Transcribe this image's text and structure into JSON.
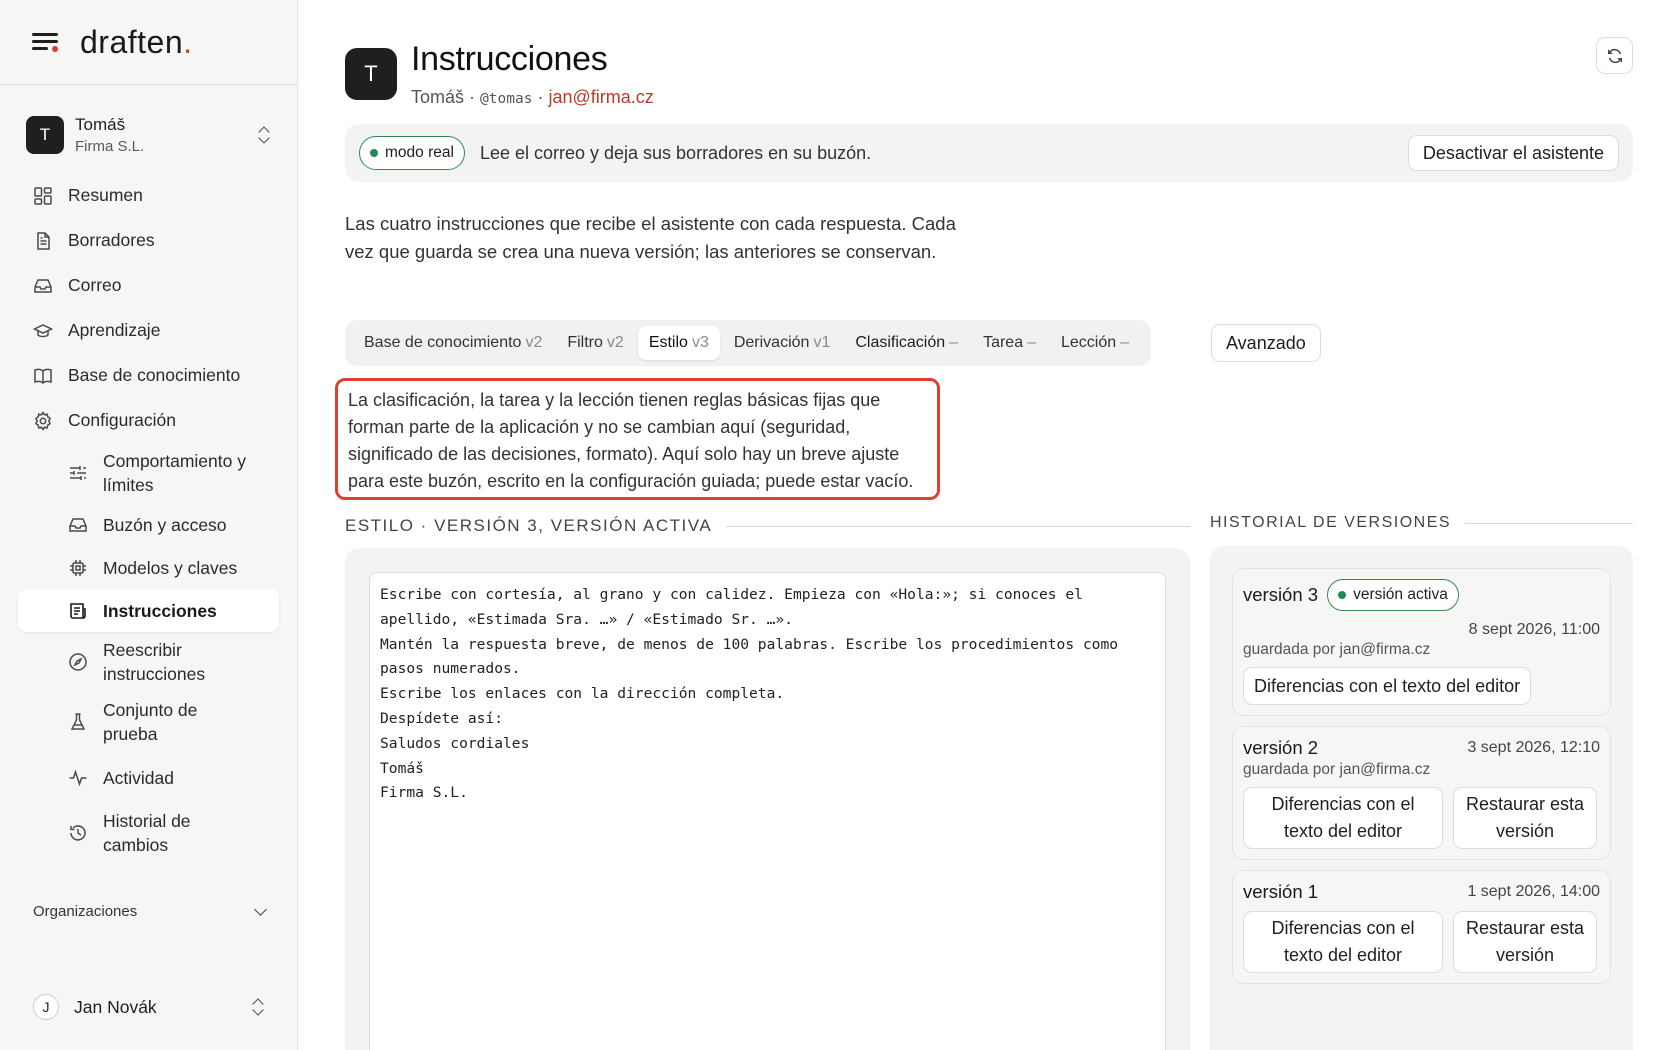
{
  "brand": {
    "name": "draften",
    "dot": "."
  },
  "account": {
    "initial": "T",
    "name": "Tomáš",
    "company": "Firma S.L."
  },
  "nav": {
    "items": [
      {
        "label": "Resumen",
        "icon": "dashboard-icon"
      },
      {
        "label": "Borradores",
        "icon": "document-icon"
      },
      {
        "label": "Correo",
        "icon": "inbox-icon"
      },
      {
        "label": "Aprendizaje",
        "icon": "graduation-cap-icon"
      },
      {
        "label": "Base de conocimiento",
        "icon": "book-icon"
      },
      {
        "label": "Configuración",
        "icon": "gear-icon"
      }
    ],
    "sub_items": [
      {
        "label": "Comportamiento y límites",
        "icon": "sliders-icon"
      },
      {
        "label": "Buzón y acceso",
        "icon": "inbox-icon"
      },
      {
        "label": "Modelos y claves",
        "icon": "chip-icon"
      },
      {
        "label": "Instrucciones",
        "icon": "instructions-icon"
      },
      {
        "label": "Reescribir instrucciones",
        "icon": "compass-icon"
      },
      {
        "label": "Conjunto de prueba",
        "icon": "flask-icon"
      },
      {
        "label": "Actividad",
        "icon": "activity-icon"
      },
      {
        "label": "Historial de cambios",
        "icon": "history-icon"
      }
    ],
    "orgs_label": "Organizaciones"
  },
  "user": {
    "initial": "J",
    "name": "Jan Novák"
  },
  "header": {
    "initial": "T",
    "title": "Instrucciones",
    "name": "Tomáš",
    "sep": "·",
    "handle": "@tomas",
    "email": "jan@firma.cz"
  },
  "mode": {
    "badge": "modo real",
    "description": "Lee el correo y deja sus borradores en su buzón.",
    "deactivate_label": "Desactivar el asistente"
  },
  "intro_text": "Las cuatro instrucciones que recibe el asistente con cada respuesta. Cada vez que guarda se crea una nueva versión; las anteriores se conservan.",
  "tabs": [
    {
      "label": "Base de conocimiento",
      "version": "v2"
    },
    {
      "label": "Filtro",
      "version": "v2"
    },
    {
      "label": "Estilo",
      "version": "v3"
    },
    {
      "label": "Derivación",
      "version": "v1"
    },
    {
      "label": "Clasificación",
      "version": "–"
    },
    {
      "label": "Tarea",
      "version": "–"
    },
    {
      "label": "Lección",
      "version": "–"
    }
  ],
  "advanced_label": "Avanzado",
  "note_text": "La clasificación, la tarea y la lección tienen reglas básicas fijas que forman parte de la aplicación y no se cambian aquí (seguridad, significado de las decisiones, formato). Aquí solo hay un breve ajuste para este buzón, escrito en la configuración guiada; puede estar vacío.",
  "editor": {
    "heading": "Estilo · versión 3, versión activa",
    "content": "Escribe con cortesía, al grano y con calidez. Empieza con «Hola:»; si conoces el\napellido, «Estimada Sra. …» / «Estimado Sr. …».\nMantén la respuesta breve, de menos de 100 palabras. Escribe los procedimientos como\npasos numerados.\nEscribe los enlaces con la dirección completa.\nDespídete así:\nSaludos cordiales\nTomáš\nFirma S.L."
  },
  "history": {
    "heading": "Historial de versiones",
    "versions": [
      {
        "name": "versión 3",
        "badge": "versión activa",
        "date": "8 sept 2026, 11:00",
        "by": "guardada por jan@firma.cz",
        "diff_label": "Diferencias con el texto del editor"
      },
      {
        "name": "versión 2",
        "date": "3 sept 2026, 12:10",
        "by": "guardada por jan@firma.cz",
        "diff_label": "Diferencias con el texto del editor",
        "restore_label": "Restaurar esta versión"
      },
      {
        "name": "versión 1",
        "date": "1 sept 2026, 14:00",
        "diff_label": "Diferencias con el texto del editor",
        "restore_label": "Restaurar esta versión"
      }
    ]
  },
  "colors": {
    "accent": "#d2402c",
    "active_badge": "#2f8a5a",
    "highlight_border": "#e0412e"
  }
}
